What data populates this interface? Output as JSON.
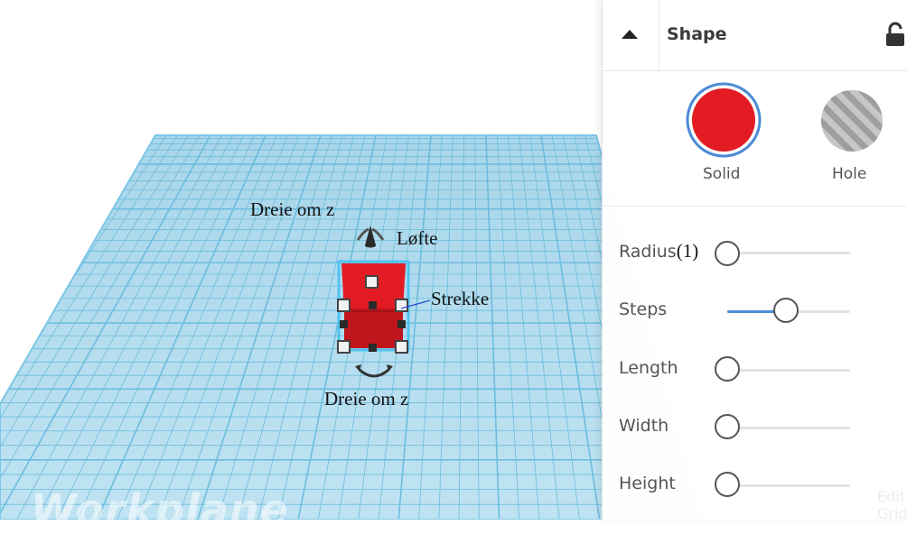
{
  "workplane": {
    "label": "Workplane",
    "annotations": {
      "rotate_top": "Dreie om z",
      "lift": "Løfte",
      "stretch": "Strekke",
      "rotate_bottom": "Dreie om z"
    }
  },
  "inspector": {
    "title": "Shape",
    "solid_label": "Solid",
    "hole_label": "Hole",
    "solid_color": "#e31c24",
    "accent_color": "#4a8bd6",
    "params": [
      {
        "label": "Radius",
        "suffix": "(1)",
        "value": 0.0
      },
      {
        "label": "Steps",
        "value": 0.48
      },
      {
        "label": "Length",
        "value": 0.0
      },
      {
        "label": "Width",
        "value": 0.0
      },
      {
        "label": "Height",
        "value": 0.0
      }
    ],
    "edit_grid": "Edit Grid"
  },
  "icons": {
    "collapse": "triangle-up-icon",
    "lock": "lock-open-icon",
    "hole_swatch": "striped-circle-icon",
    "lift_handle": "cone-arrow-icon",
    "rotate_handle": "curved-double-arrow-icon"
  }
}
